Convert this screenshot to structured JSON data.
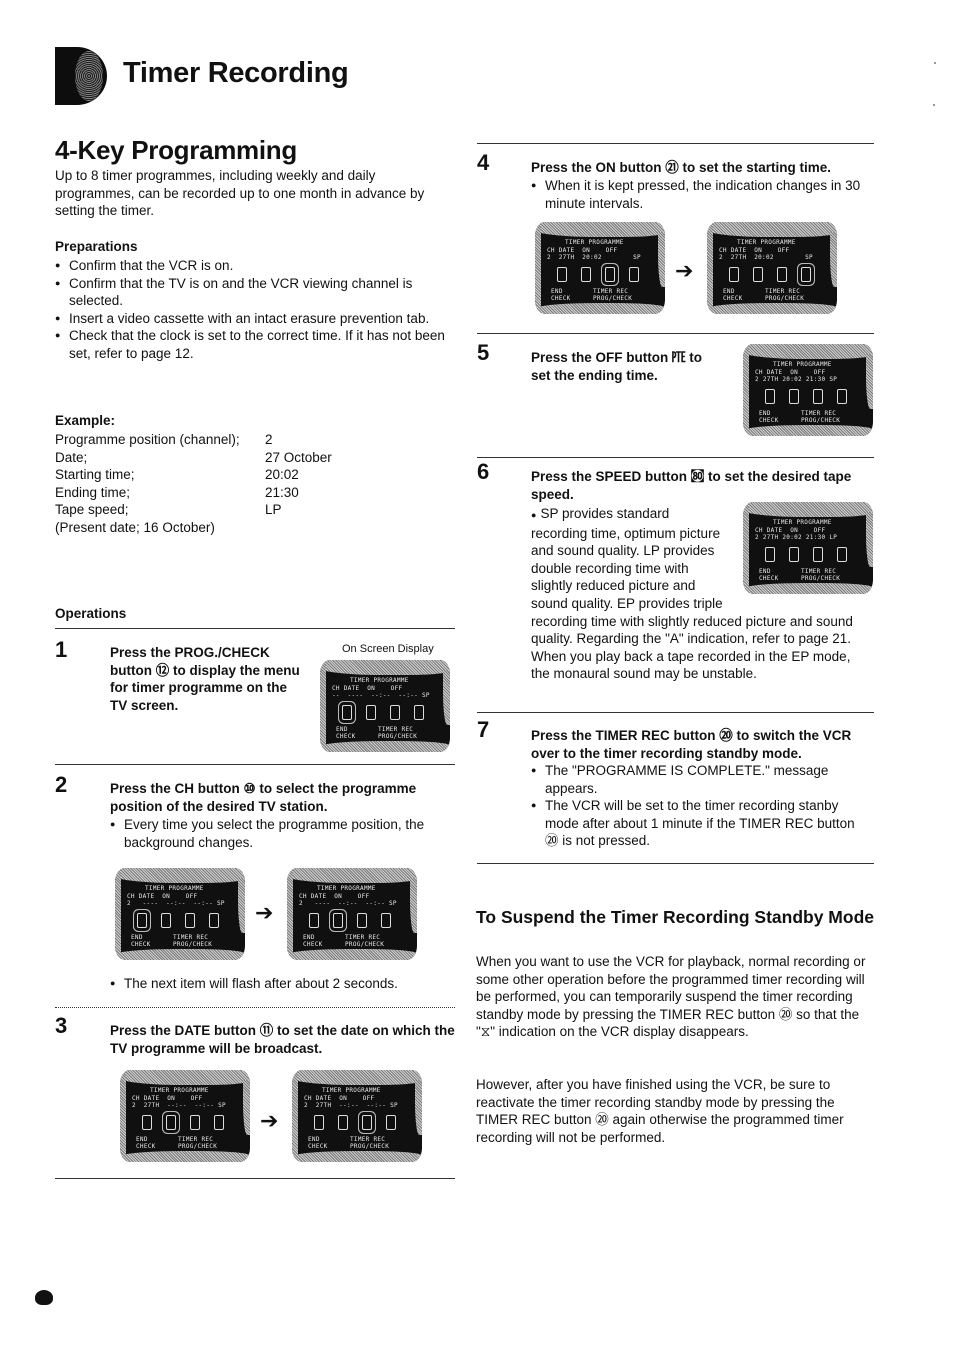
{
  "header": {
    "title": "Timer Recording",
    "section_tab_icon": "section-tab-marker"
  },
  "section": {
    "title": "4-Key Programming",
    "intro": "Up to 8 timer programmes, including weekly and daily programmes, can be recorded up to one month in advance by setting the timer."
  },
  "preparations": {
    "heading": "Preparations",
    "items": [
      "Confirm that the VCR is on.",
      "Confirm that the TV is on and the VCR viewing channel is selected.",
      "Insert a video cassette with an intact erasure prevention tab.",
      "Check that the clock is set to the correct time. If it has not been set, refer to page 12."
    ]
  },
  "example": {
    "heading": "Example:",
    "rows": [
      {
        "label": "Programme position (channel);",
        "value": "2"
      },
      {
        "label": "Date;",
        "value": "27 October"
      },
      {
        "label": "Starting time;",
        "value": "20:02"
      },
      {
        "label": "Ending time;",
        "value": "21:30"
      },
      {
        "label": "Tape speed;",
        "value": "LP"
      }
    ],
    "note": "(Present date; 16 October)"
  },
  "operations": {
    "heading": "Operations",
    "osd_caption": "On Screen Display",
    "steps": [
      {
        "num": "1",
        "head": "Press the PROG./CHECK button ⑫ to display the menu for timer programme on the TV screen.",
        "bullets": []
      },
      {
        "num": "2",
        "head": "Press the CH button ⑩ to select the programme position of the desired TV station.",
        "bullets": [
          "Every time you select the programme position, the background changes.",
          "The next item will flash after about 2 seconds."
        ]
      },
      {
        "num": "3",
        "head": "Press the DATE button ⑪ to set the date on which the TV programme will be broadcast.",
        "bullets": []
      },
      {
        "num": "4",
        "head": "Press the ON button ㉑ to set the starting time.",
        "bullets": [
          "When it is kept pressed, the indication changes in 30 minute intervals."
        ]
      },
      {
        "num": "5",
        "head": "Press the OFF button ㉐ to set the ending time.",
        "bullets": []
      },
      {
        "num": "6",
        "head": "Press the SPEED button ㉏ to set the desired tape speed.",
        "bullets": [
          "SP provides standard recording time, optimum picture and sound quality. LP provides double recording time with slightly reduced picture and sound quality. EP provides triple recording time with slightly reduced picture and sound quality. Regarding the \"A\" indication, refer to page 21. When you play back a tape recorded in the EP mode, the monaural sound may be unstable."
        ]
      },
      {
        "num": "7",
        "head": "Press the TIMER REC button ⑳ to switch the VCR over to the timer recording standby mode.",
        "bullets": [
          "The \"PROGRAMME IS COMPLETE.\" message appears.",
          "The VCR will be set to the timer recording stanby mode after about 1 minute if the TIMER REC button ⑳ is not pressed."
        ]
      }
    ]
  },
  "osd": {
    "title": "TIMER PROGRAMME",
    "columns": "CH DATE  ON    OFF",
    "footer_left": "END\nCHECK",
    "footer_right": "TIMER REC\nPROG/CHECK",
    "screens": {
      "s1": "--  ----  --:--  --:-- SP",
      "s2a": "2   ----  --:--  --:-- SP",
      "s2b": "2   ----  --:--  --:-- SP",
      "s3a": "2  27TH  --:--  --:-- SP",
      "s3b": "2  27TH  --:--  --:-- SP",
      "s4a": "2  27TH  20:02        SP",
      "s4b": "2  27TH  20:02        SP",
      "s5": "2 27TH 20:02 21:30 SP",
      "s6": "2 27TH 20:02 21:30 LP"
    }
  },
  "suspend": {
    "title": "To Suspend the Timer Recording Standby Mode",
    "para1": "When you want to use the VCR for playback, normal recording or some other operation before the programmed timer recording will be performed, you can temporarily suspend the timer recording standby mode by pressing the TIMER REC button ⑳ so that the \"⧖\" indication on the VCR display disappears.",
    "para2": "However, after you have finished using the VCR, be sure to reactivate the timer recording standby mode by pressing the TIMER REC button ⑳ again otherwise the programmed timer recording will not be performed."
  }
}
